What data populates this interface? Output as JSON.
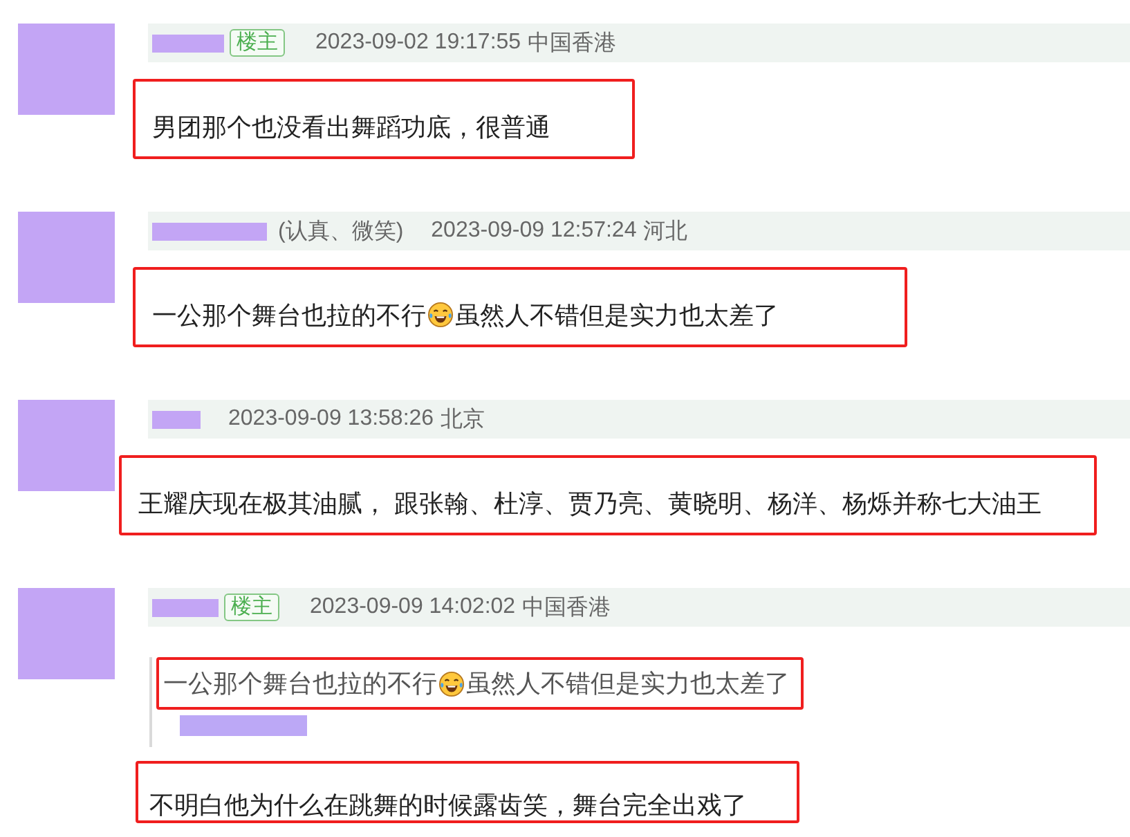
{
  "comments": [
    {
      "author_hidden": true,
      "badge": "楼主",
      "time": "2023-09-02 19:17:55",
      "location": "中国香港",
      "content": {
        "highlighted": true,
        "segments": [
          {
            "kind": "text",
            "text": "男团那个也没看出舞蹈功底，很普通"
          }
        ]
      }
    },
    {
      "author_hidden": true,
      "remark": "(认真、微笑)",
      "time": "2023-09-09 12:57:24",
      "location": "河北",
      "content": {
        "highlighted": true,
        "segments": [
          {
            "kind": "text",
            "text": "一公那个舞台也拉的不行"
          },
          {
            "kind": "emoji"
          },
          {
            "kind": "text",
            "text": "虽然人不错但是实力也太差了"
          }
        ]
      }
    },
    {
      "author_hidden": true,
      "time": "2023-09-09 13:58:26",
      "location": "北京",
      "content": {
        "highlighted": true,
        "segments": [
          {
            "kind": "text",
            "text": "王耀庆现在极其油腻， 跟张翰、杜淳、贾乃亮、黄晓明、杨洋、杨烁并称七大油王"
          }
        ]
      }
    },
    {
      "author_hidden": true,
      "badge": "楼主",
      "time": "2023-09-09 14:02:02",
      "location": "中国香港",
      "quote": {
        "highlighted": true,
        "author_hidden": true,
        "segments": [
          {
            "kind": "text",
            "text": "一公那个舞台也拉的不行"
          },
          {
            "kind": "emoji"
          },
          {
            "kind": "text",
            "text": "虽然人不错但是实力也太差了"
          }
        ]
      },
      "content": {
        "highlighted": true,
        "segments": [
          {
            "kind": "text",
            "text": "不明白他为什么在跳舞的时候露齿笑，舞台完全出戏了"
          }
        ]
      }
    }
  ]
}
